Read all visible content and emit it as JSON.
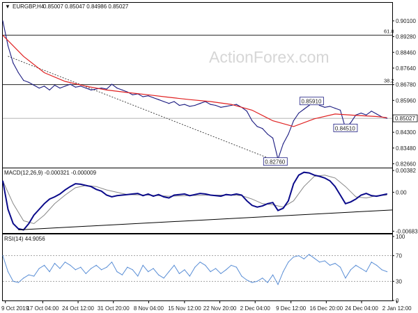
{
  "chart_data": {
    "type": "line",
    "watermark": "ActionForex.com",
    "price_panel": {
      "header": {
        "marker": "▼",
        "symbol": "EURGBP,H4",
        "ohlc": "0.85007 0.85047 0.84986 0.85027"
      },
      "ylim": [
        0.8246,
        0.9104
      ],
      "y_ticks": [
        {
          "value": 0.901,
          "label": "0.90100"
        },
        {
          "value": 0.8928,
          "label": "0.89280"
        },
        {
          "value": 0.8846,
          "label": "0.88460"
        },
        {
          "value": 0.8764,
          "label": "0.87640"
        },
        {
          "value": 0.8678,
          "label": "0.86780"
        },
        {
          "value": 0.8596,
          "label": "0.85960"
        },
        {
          "value": 0.843,
          "label": "0.84300"
        },
        {
          "value": 0.8348,
          "label": "0.83480"
        },
        {
          "value": 0.8266,
          "label": "0.82660"
        }
      ],
      "current_price": {
        "value": 0.85027,
        "label": "0.85027"
      },
      "fib_levels": [
        {
          "label": "61.8",
          "value": 0.8935
        },
        {
          "label": "38.2",
          "value": 0.8678
        }
      ],
      "price_labels": [
        {
          "label": "0.85910",
          "value": 0.8591,
          "x": 59.5
        },
        {
          "label": "0.84510",
          "value": 0.8451,
          "x": 66
        },
        {
          "label": "0.82760",
          "value": 0.8276,
          "x": 52.5
        }
      ],
      "trendline": {
        "x": [
          1,
          53
        ],
        "y": [
          0.8826,
          0.8276
        ]
      },
      "price_series": {
        "x": [
          0,
          1,
          2,
          3,
          4,
          5,
          6,
          7,
          8,
          9,
          10,
          11,
          12,
          13,
          14,
          15,
          16,
          17,
          18,
          19,
          20,
          21,
          22,
          23,
          24,
          25,
          26,
          27,
          28,
          29,
          30,
          31,
          32,
          33,
          34,
          35,
          36,
          37,
          38,
          39,
          40,
          41,
          42,
          43,
          44,
          45,
          46,
          47,
          48,
          49,
          50,
          51,
          52,
          53,
          54,
          55,
          56,
          57,
          58,
          59,
          60,
          61,
          62,
          63,
          64,
          65,
          66,
          67,
          68,
          69,
          70,
          71,
          72,
          73,
          74
        ],
        "y": [
          0.901,
          0.888,
          0.879,
          0.874,
          0.87,
          0.869,
          0.8675,
          0.866,
          0.867,
          0.865,
          0.8675,
          0.866,
          0.867,
          0.868,
          0.8665,
          0.867,
          0.866,
          0.865,
          0.8655,
          0.866,
          0.8655,
          0.868,
          0.866,
          0.865,
          0.864,
          0.8625,
          0.863,
          0.8615,
          0.862,
          0.861,
          0.86,
          0.859,
          0.858,
          0.859,
          0.857,
          0.8575,
          0.8565,
          0.857,
          0.858,
          0.859,
          0.8575,
          0.857,
          0.856,
          0.8565,
          0.857,
          0.8575,
          0.856,
          0.854,
          0.849,
          0.846,
          0.845,
          0.842,
          0.84,
          0.829,
          0.837,
          0.842,
          0.849,
          0.853,
          0.855,
          0.857,
          0.8591,
          0.857,
          0.856,
          0.8565,
          0.8555,
          0.8545,
          0.8451,
          0.848,
          0.852,
          0.853,
          0.852,
          0.854,
          0.8525,
          0.851,
          0.85027
        ]
      },
      "moving_average": {
        "x": [
          0,
          4,
          8,
          12,
          16,
          20,
          24,
          28,
          32,
          36,
          40,
          44,
          48,
          52,
          56,
          60,
          64,
          68,
          72,
          74
        ],
        "y": [
          0.8935,
          0.8825,
          0.874,
          0.8695,
          0.867,
          0.865,
          0.8637,
          0.8625,
          0.8612,
          0.86,
          0.859,
          0.8575,
          0.8545,
          0.849,
          0.846,
          0.85,
          0.8525,
          0.8518,
          0.8512,
          0.8506
        ]
      }
    },
    "macd_panel": {
      "header": "MACD(12,26,9) -0.000321 -0.000009",
      "ylim": [
        -0.00715,
        0.0042
      ],
      "y_ticks": [
        {
          "value": 0.00382,
          "label": "0.00382"
        },
        {
          "value": 0.0,
          "label": "0.00"
        },
        {
          "value": -0.00683,
          "label": "-0.00683"
        }
      ],
      "macd_line": {
        "x": [
          0,
          1,
          2,
          3,
          4,
          5,
          6,
          7,
          8,
          9,
          10,
          11,
          12,
          13,
          14,
          15,
          16,
          17,
          18,
          19,
          20,
          21,
          22,
          23,
          24,
          25,
          26,
          27,
          28,
          29,
          30,
          31,
          32,
          33,
          34,
          35,
          36,
          37,
          38,
          39,
          40,
          41,
          42,
          43,
          44,
          45,
          46,
          47,
          48,
          49,
          50,
          51,
          52,
          53,
          54,
          55,
          56,
          57,
          58,
          59,
          60,
          61,
          62,
          63,
          64,
          65,
          66,
          67,
          68,
          69,
          70,
          71,
          72,
          73,
          74
        ],
        "y": [
          0.002,
          -0.003,
          -0.0055,
          -0.0064,
          -0.0066,
          -0.0055,
          -0.004,
          -0.003,
          -0.002,
          -0.0012,
          -0.0008,
          -0.0003,
          0.0004,
          0.001,
          0.0015,
          0.0014,
          0.0012,
          0.001,
          0.0005,
          0.0002,
          -0.0005,
          -0.0008,
          -0.0006,
          -0.0005,
          -0.0004,
          -0.0003,
          -0.0002,
          -0.0006,
          -0.0003,
          -0.0007,
          -0.0004,
          -0.0008,
          -0.001,
          -0.0005,
          -0.0004,
          -0.0003,
          -0.0006,
          -0.0004,
          -0.0002,
          -0.0003,
          -0.0005,
          -0.0006,
          -0.0007,
          -0.0004,
          -0.0005,
          -0.0003,
          -0.0005,
          -0.0015,
          -0.0023,
          -0.0026,
          -0.0024,
          -0.002,
          -0.0018,
          -0.0032,
          -0.0028,
          -0.0015,
          0.0015,
          0.003,
          0.0035,
          0.0034,
          0.003,
          0.0028,
          0.0025,
          0.002,
          0.001,
          -0.0005,
          -0.002,
          -0.0017,
          -0.0012,
          -0.0005,
          -0.0002,
          -0.0006,
          -0.0007,
          -0.0005,
          -0.0003
        ]
      },
      "signal_line": {
        "x": [
          0,
          2,
          4,
          6,
          8,
          10,
          12,
          14,
          16,
          18,
          20,
          24,
          28,
          32,
          36,
          40,
          44,
          46,
          48,
          50,
          52,
          54,
          56,
          58,
          60,
          62,
          64,
          66,
          68,
          70,
          72,
          74
        ],
        "y": [
          0.002,
          -0.002,
          -0.005,
          -0.0055,
          -0.004,
          -0.002,
          -0.0005,
          0.0008,
          0.0012,
          0.001,
          0.0004,
          -0.0004,
          -0.0005,
          -0.0007,
          -0.0006,
          -0.0005,
          -0.0005,
          -0.0006,
          -0.0012,
          -0.002,
          -0.0022,
          -0.0026,
          -0.0015,
          0.001,
          0.0028,
          0.003,
          0.0025,
          0.001,
          -0.0008,
          -0.001,
          -0.0006,
          -0.0005
        ]
      },
      "trendline": {
        "x": [
          3,
          75
        ],
        "y": [
          -0.0066,
          -0.0031
        ]
      }
    },
    "rsi_panel": {
      "header": "RSI(14) 44.9056",
      "ylim": [
        0,
        100
      ],
      "y_ticks": [
        {
          "value": 100,
          "label": "100"
        },
        {
          "value": 70,
          "label": "70"
        },
        {
          "value": 30,
          "label": "30"
        },
        {
          "value": 0,
          "label": "0"
        }
      ],
      "levels": [
        70,
        30
      ],
      "rsi_line": {
        "x": [
          0,
          1,
          2,
          3,
          4,
          5,
          6,
          7,
          8,
          9,
          10,
          11,
          12,
          13,
          14,
          15,
          16,
          17,
          18,
          19,
          20,
          21,
          22,
          23,
          24,
          25,
          26,
          27,
          28,
          29,
          30,
          31,
          32,
          33,
          34,
          35,
          36,
          37,
          38,
          39,
          40,
          41,
          42,
          43,
          44,
          45,
          46,
          47,
          48,
          49,
          50,
          51,
          52,
          53,
          54,
          55,
          56,
          57,
          58,
          59,
          60,
          61,
          62,
          63,
          64,
          65,
          66,
          67,
          68,
          69,
          70,
          71,
          72,
          73,
          74
        ],
        "y": [
          70,
          45,
          30,
          28,
          35,
          40,
          38,
          50,
          55,
          45,
          58,
          50,
          60,
          55,
          48,
          52,
          42,
          50,
          55,
          48,
          52,
          60,
          45,
          40,
          52,
          48,
          38,
          55,
          45,
          50,
          40,
          35,
          45,
          55,
          42,
          48,
          38,
          52,
          60,
          55,
          45,
          50,
          42,
          48,
          55,
          52,
          38,
          32,
          28,
          30,
          35,
          28,
          40,
          25,
          45,
          60,
          68,
          70,
          65,
          72,
          66,
          60,
          62,
          55,
          58,
          52,
          35,
          48,
          55,
          50,
          45,
          60,
          55,
          48,
          45
        ]
      }
    },
    "x_axis": {
      "range": [
        0,
        75
      ],
      "ticks": [
        {
          "x": 0.5,
          "label": "9 Oct 2019"
        },
        {
          "x": 7.7,
          "label": "17 Oct 04:00"
        },
        {
          "x": 14.5,
          "label": "24 Oct 12:00"
        },
        {
          "x": 21.3,
          "label": "31 Oct 20:00"
        },
        {
          "x": 28.1,
          "label": "8 Nov 04:00"
        },
        {
          "x": 35.0,
          "label": "15 Nov 12:00"
        },
        {
          "x": 41.8,
          "label": "22 Nov 20:00"
        },
        {
          "x": 48.6,
          "label": "2 Dec 04:00"
        },
        {
          "x": 55.5,
          "label": "9 Dec 12:00"
        },
        {
          "x": 62.3,
          "label": "16 Dec 20:00"
        },
        {
          "x": 69.1,
          "label": "24 Dec 04:00"
        },
        {
          "x": 75.9,
          "label": "2 Jan 12:00"
        }
      ]
    },
    "colors": {
      "price": "#1a1a80",
      "moving_average": "#e02020",
      "macd": "#0a0a8a",
      "signal": "#888888",
      "rsi": "#5b8fd6",
      "fib": "#222222",
      "grid": "#000000"
    }
  }
}
